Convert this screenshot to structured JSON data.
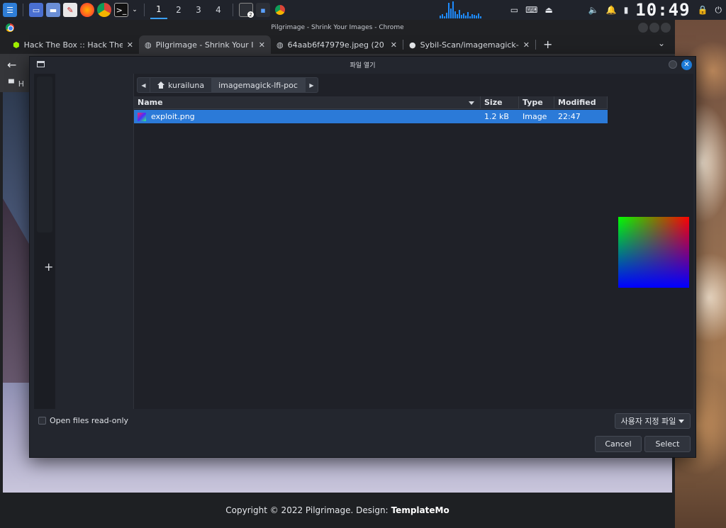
{
  "colors": {
    "accent": "#2b7ad8",
    "panel": "#20232b",
    "dialog_bg": "#23262e",
    "list_bg": "#1f2128"
  },
  "top_panel": {
    "workspaces": [
      "1",
      "2",
      "3",
      "4"
    ],
    "active_workspace": "1",
    "clock": "10:49",
    "launcher_icons": [
      "kali-menu-icon",
      "desktop-icon",
      "file-manager-icon",
      "text-editor-icon",
      "firefox-icon",
      "chrome-icon",
      "terminal-icon"
    ],
    "tray_icons": [
      "display-icon",
      "keyboard-icon",
      "network-icon",
      "volume-icon",
      "notification-icon",
      "battery-icon",
      "lock-icon",
      "power-icon"
    ],
    "terminal_badge": "2"
  },
  "browser": {
    "window_title": "Pilgrimage - Shrink Your Images - Chrome",
    "tabs": [
      {
        "label": "Hack The Box :: Hack The B",
        "icon": "htb-cube-icon",
        "active": false
      },
      {
        "label": "Pilgrimage - Shrink Your I",
        "icon": "globe-icon",
        "active": true
      },
      {
        "label": "64aab6f47979e.jpeg (20",
        "icon": "globe-icon",
        "active": false
      },
      {
        "label": "Sybil-Scan/imagemagick-",
        "icon": "github-icon",
        "active": false
      }
    ],
    "new_tab": "+",
    "tab_menu": "⌄",
    "bookmark_initial": "H",
    "footer": {
      "text": "Copyright © 2022 Pilgrimage. Design:",
      "link": "TemplateMo"
    }
  },
  "dialog": {
    "title": "파일 열기",
    "path": [
      {
        "label": "kurailuna",
        "home": true
      },
      {
        "label": "imagemagick-lfi-poc",
        "home": false
      }
    ],
    "columns": {
      "name": "Name",
      "size": "Size",
      "type": "Type",
      "modified": "Modified"
    },
    "files": [
      {
        "name": "exploit.png",
        "size": "1.2 kB",
        "type": "Image",
        "modified": "22:47",
        "selected": true
      }
    ],
    "add_bookmark": "+",
    "readonly_label": "Open files read-only",
    "filter_label": "사용자 지정 파일",
    "cancel_label": "Cancel",
    "select_label": "Select"
  }
}
